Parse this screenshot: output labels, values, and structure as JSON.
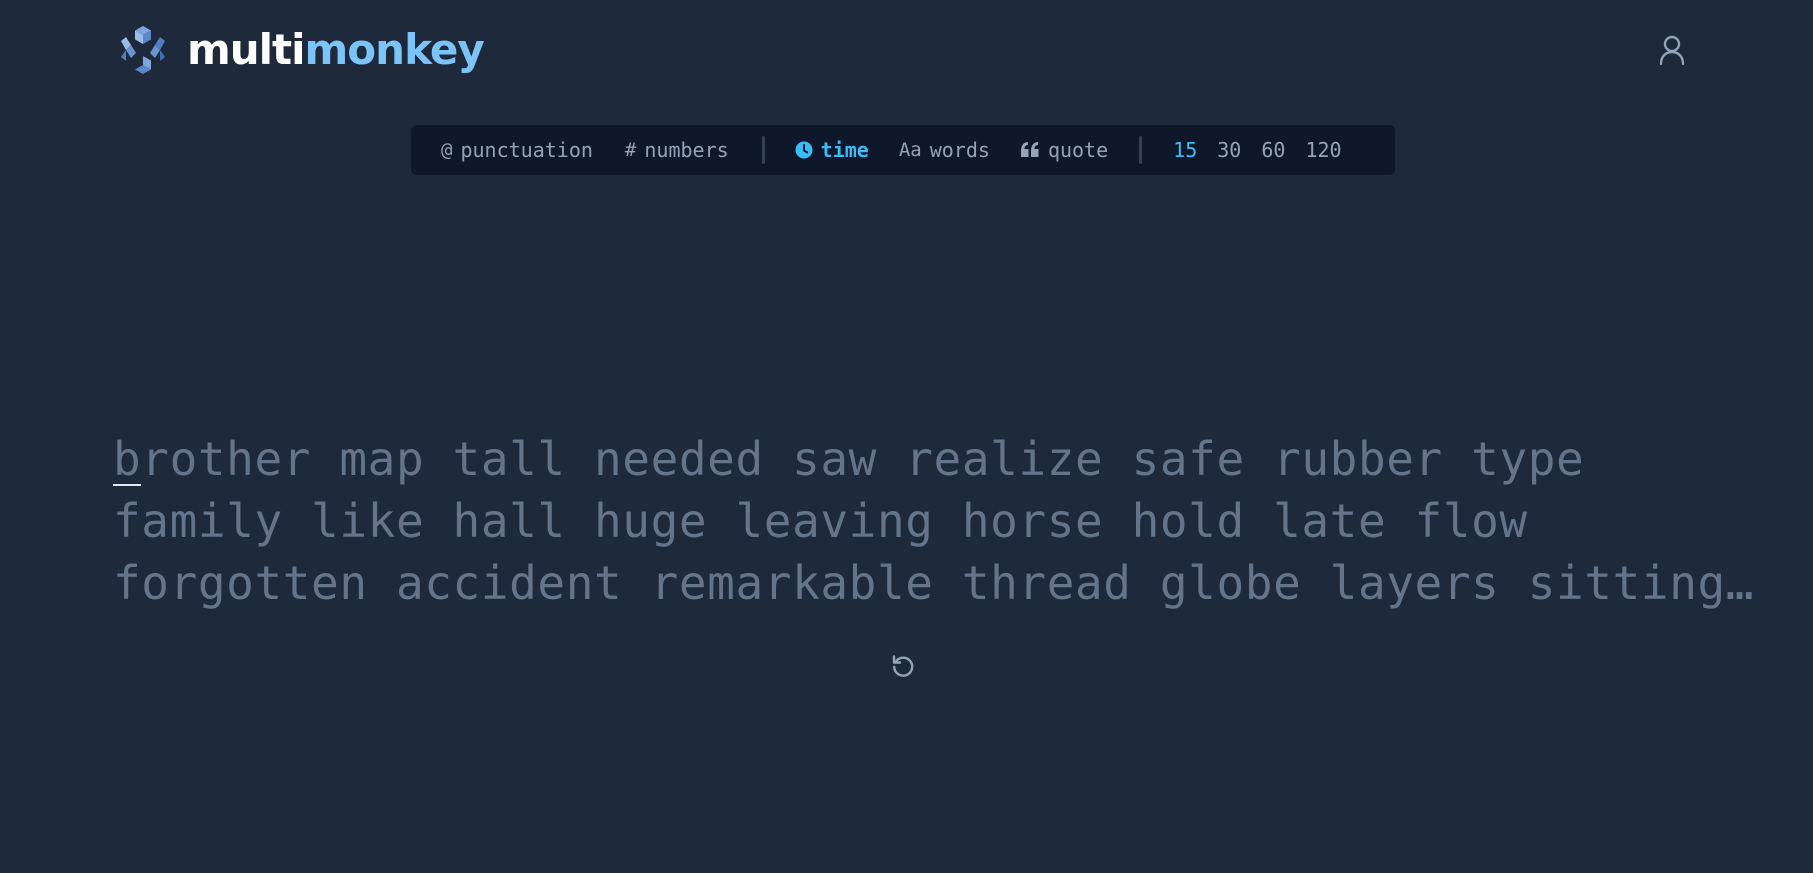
{
  "brand": {
    "name_part1": "multi",
    "name_part2": "monkey",
    "logo_icon": "hexagon-cube-logo"
  },
  "header": {
    "user_icon": "user-icon"
  },
  "config": {
    "modifiers": [
      {
        "icon": "@",
        "label": "punctuation"
      },
      {
        "icon": "#",
        "label": "numbers"
      }
    ],
    "modes": [
      {
        "icon": "clock-icon",
        "label": "time",
        "active": true
      },
      {
        "icon": "Aa",
        "label": "words",
        "active": false
      },
      {
        "icon": "quote-icon",
        "label": "quote",
        "active": false
      }
    ],
    "durations": [
      "15",
      "30",
      "60",
      "120"
    ],
    "selected_duration": "15"
  },
  "test": {
    "first_letter": "b",
    "line1_rest": "rother map tall needed saw realize safe rubber type",
    "line2": "family like hall huge leaving horse hold late flow",
    "line3": "forgotten accident remarkable thread globe layers sitting…"
  },
  "controls": {
    "restart_icon": "restart-icon"
  },
  "colors": {
    "background": "#1e293b",
    "bar": "#0f172a",
    "accent": "#38bdf8",
    "brand_light": "#7cc4f8",
    "text_dim": "#64748b",
    "text_muted": "#94a3b8"
  }
}
